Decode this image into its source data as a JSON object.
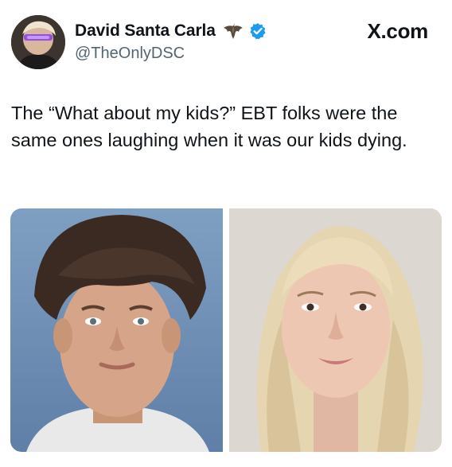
{
  "author": {
    "display_name": "David Santa Carla",
    "handle": "@TheOnlyDSC",
    "avatar_icon": "avatar-photo",
    "badge_icons": [
      "bat-emoji-icon",
      "verified-badge-icon"
    ],
    "verified_color": "#1d9bf0"
  },
  "source": {
    "label": "X.com"
  },
  "post": {
    "text": "The “What about my kids?” EBT folks were the same ones laughing when it was our kids dying."
  },
  "media": {
    "photos": [
      {
        "subject": "young man portrait",
        "background": "#6f91b6"
      },
      {
        "subject": "young woman portrait",
        "background": "#d8d3cd"
      }
    ]
  },
  "colors": {
    "text_primary": "#0f1419",
    "text_secondary": "#536471",
    "background": "#ffffff"
  }
}
